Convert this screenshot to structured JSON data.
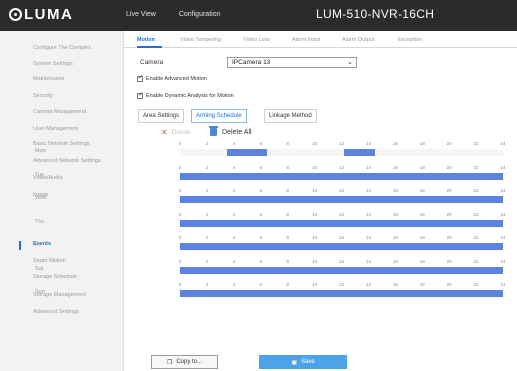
{
  "app": {
    "brand": "LUMA",
    "device_name": "LUM-510-NVR-16CH",
    "top_nav": [
      "Live View",
      "Configuration"
    ]
  },
  "sidebar": {
    "items": [
      {
        "label": "Configure The Complex"
      },
      {
        "label": "System Settings"
      },
      {
        "label": "Maintenance"
      },
      {
        "label": "Security"
      },
      {
        "label": "Camera Management"
      },
      {
        "label": "User Management"
      },
      {
        "label": "Basic Network Settings"
      },
      {
        "label": "Advanced Network Settings"
      },
      {
        "label": "Video/Audio"
      },
      {
        "label": "Image"
      },
      {
        "label": "Events"
      },
      {
        "label": "Smart Motion"
      },
      {
        "label": "Storage Schedule"
      },
      {
        "label": "Storage Management"
      },
      {
        "label": "Advanced Settings"
      }
    ],
    "active_index": 10
  },
  "tabs": [
    "Motion",
    "Video Tampering",
    "Video Loss",
    "Alarm Input",
    "Alarm Output",
    "Exception"
  ],
  "camera": {
    "label": "Camera",
    "value": "IPCamera 13"
  },
  "checks": [
    {
      "label": "Enable Advanced Motion",
      "checked": true
    },
    {
      "label": "Enable Dynamic Analysis for Motion",
      "checked": true
    }
  ],
  "subtabs": [
    "Area Settings",
    "Arming Schedule",
    "Linkage Method"
  ],
  "schedule_actions": {
    "delete": "Delete",
    "delete_all": "Delete All"
  },
  "schedule": {
    "hours": [
      "0",
      "2",
      "4",
      "6",
      "8",
      "10",
      "12",
      "14",
      "16",
      "18",
      "20",
      "22",
      "24"
    ],
    "days": [
      {
        "label": "Mon",
        "segments": [
          [
            3.5,
            6.5
          ],
          [
            12.2,
            14.5
          ]
        ]
      },
      {
        "label": "Tue",
        "segments": [
          [
            0,
            24
          ]
        ]
      },
      {
        "label": "Wed",
        "segments": [
          [
            0,
            24
          ]
        ]
      },
      {
        "label": "Thu",
        "segments": [
          [
            0,
            24
          ]
        ]
      },
      {
        "label": "Fri",
        "segments": [
          [
            0,
            24
          ]
        ]
      },
      {
        "label": "Sat",
        "segments": [
          [
            0,
            24
          ]
        ]
      },
      {
        "label": "Sun",
        "segments": [
          [
            0,
            24
          ]
        ]
      }
    ]
  },
  "buttons": {
    "copy": "Copy to...",
    "save": "Save"
  },
  "colors": {
    "accent": "#1e6fd9",
    "schedule_fill": "#5d82e0",
    "topbar": "#2b2b2b",
    "save": "#4da3e8"
  }
}
